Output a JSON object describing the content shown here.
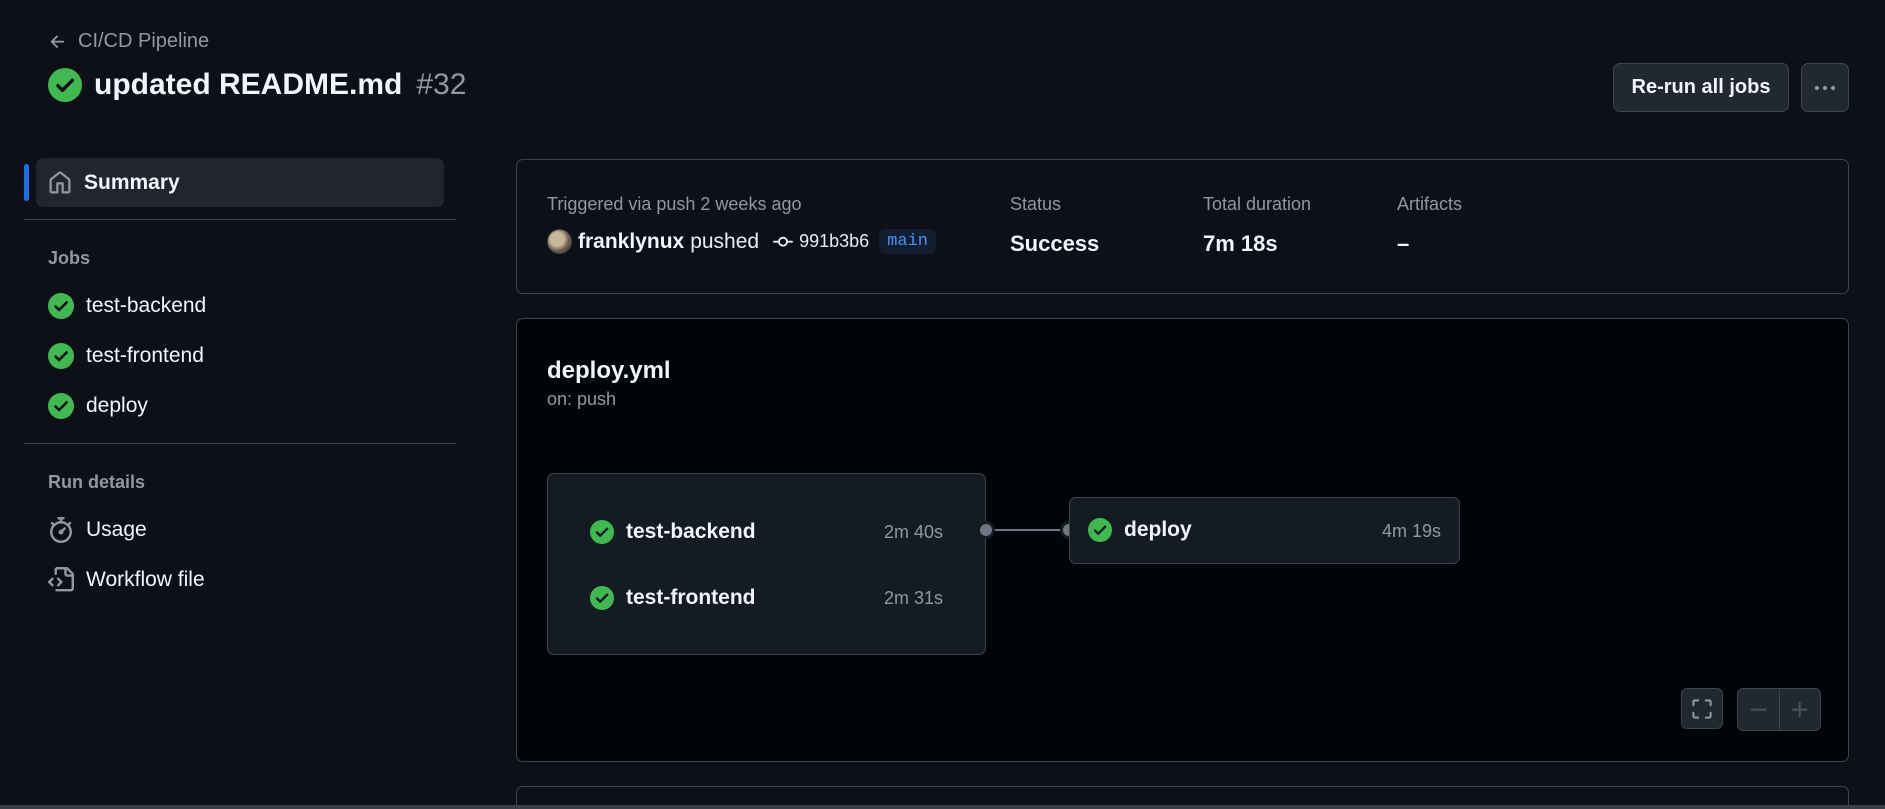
{
  "header": {
    "back_label": "CI/CD Pipeline",
    "title": "updated README.md",
    "run_number": "#32",
    "rerun_label": "Re-run all jobs"
  },
  "sidebar": {
    "summary_label": "Summary",
    "jobs_heading": "Jobs",
    "jobs": [
      {
        "label": "test-backend",
        "status": "success"
      },
      {
        "label": "test-frontend",
        "status": "success"
      },
      {
        "label": "deploy",
        "status": "success"
      }
    ],
    "run_details_heading": "Run details",
    "usage_label": "Usage",
    "workflow_file_label": "Workflow file"
  },
  "info": {
    "trigger_label": "Triggered via push 2 weeks ago",
    "actor": "franklynux",
    "action": "pushed",
    "commit_sha": "991b3b6",
    "branch": "main",
    "status_label": "Status",
    "status_value": "Success",
    "duration_label": "Total duration",
    "duration_value": "7m 18s",
    "artifacts_label": "Artifacts",
    "artifacts_value": "–"
  },
  "workflow": {
    "file_name": "deploy.yml",
    "trigger": "on: push",
    "group_jobs": [
      {
        "name": "test-backend",
        "duration": "2m 40s"
      },
      {
        "name": "test-frontend",
        "duration": "2m 31s"
      }
    ],
    "deploy_job": {
      "name": "deploy",
      "duration": "4m 19s"
    }
  },
  "colors": {
    "background": "#0d1117",
    "success": "#3fb950",
    "accent": "#1f6feb",
    "branch_text": "#4493f8"
  },
  "icons": {
    "back": "arrow-left-icon",
    "status": "check-circle-fill-icon",
    "more": "kebab-horizontal-icon",
    "summary": "home-icon",
    "usage": "stopwatch-icon",
    "workflow_file": "file-code-icon",
    "commit": "git-commit-icon",
    "fullscreen": "screen-full-icon",
    "zoom_out": "minus-icon",
    "zoom_in": "plus-icon"
  }
}
